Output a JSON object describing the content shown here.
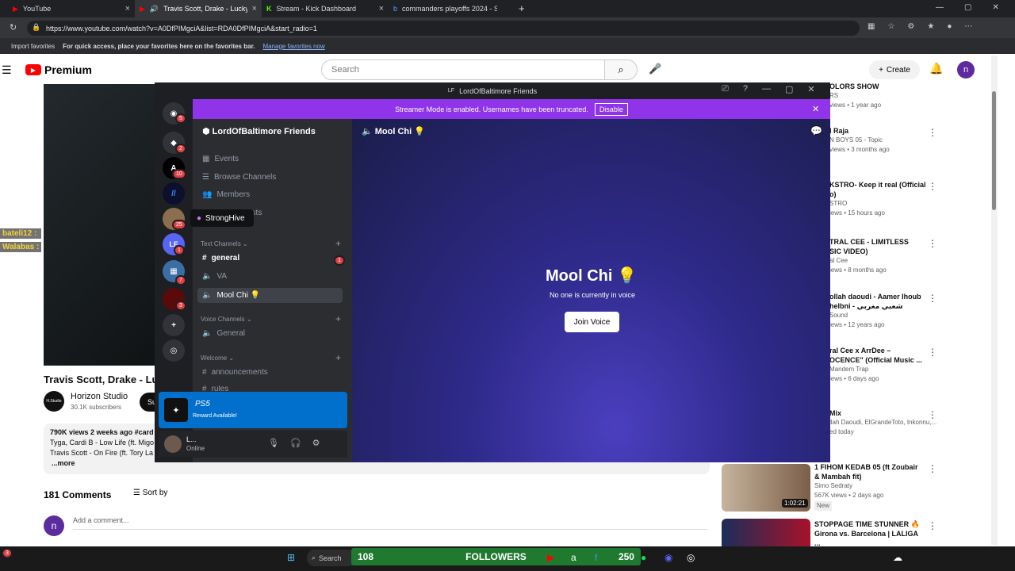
{
  "browser": {
    "tabs": [
      {
        "label": "YouTube"
      },
      {
        "label": "Travis Scott, Drake - Lucky Y"
      },
      {
        "label": "Stream - Kick Dashboard"
      },
      {
        "label": "commanders playoffs 2024 - Sea"
      }
    ],
    "url": "https://www.youtube.com/watch?v=A0DfPIMgciA&list=RDA0DfPIMgciA&start_radio=1",
    "favorites": {
      "import": "Import favorites",
      "hint": "For quick access, place your favorites here on the favorites bar.",
      "manage": "Manage favorites now"
    }
  },
  "youtube": {
    "logo": "Premium",
    "search_placeholder": "Search",
    "create": "Create",
    "avatar": "n",
    "video_title": "Travis Scott, Drake - Lu",
    "channel": {
      "name": "Horizon Studio",
      "subs": "30.1K subscribers",
      "logo_text": "H.Studio",
      "subscribe": "Su"
    },
    "desc": {
      "meta": "790K views  2 weeks ago  #card",
      "line1": "Tyga, Cardi B - Low Life (ft. Migo",
      "line2": "Travis Scott - On Fire (ft. Tory La",
      "more": "...more"
    },
    "comments": "181 Comments",
    "sort": "Sort by",
    "add_comment": "Add a comment...",
    "recs": [
      {
        "t": "OLORS SHOW",
        "m1": "RS",
        "m2": "views • 1 year ago"
      },
      {
        "t": "l Raja",
        "m1": "N BOYS 05 - Topic",
        "m2": "views • 3 months ago"
      },
      {
        "t": "KSTRO- Keep it real (Official",
        "t2": "o)",
        "m1": "STRO",
        "m2": "iews • 15 hours ago"
      },
      {
        "t": "TRAL CEE - LIMITLESS",
        "t2": "SIC VIDEO)",
        "m1": "al Cee",
        "m2": "iews • 8 months ago"
      },
      {
        "t": "ollah daoudi - Aamer lhoub",
        "t2": "helbni - شعبي مغربي",
        "m1": "Sound",
        "m2": "iews • 12 years ago"
      },
      {
        "t": "ral Cee x ArrDee –",
        "t2": "OCENCE\" (Official Music ...",
        "m1": "Mandem Trap",
        "m2": "iews • 6 days ago"
      },
      {
        "t": "Mix",
        "m1": "llah Daoudi, ElGrandeToto, Inkonnu,...",
        "m2": "ed today"
      },
      {
        "t": "1 FIHOM KEDAB 05 (ft Zoubair",
        "t2": "& Mambah fit)",
        "m1": "Simo Sedraty",
        "m2": "567K views • 2 days ago",
        "m3": "New",
        "dur": "1:02:21"
      },
      {
        "t": "STOPPAGE TIME STUNNER 🔥",
        "t2": "Girona vs. Barcelona | LALIGA ..."
      }
    ]
  },
  "overlay": {
    "chat1": "bateli12 :",
    "chat2": "Walabas :"
  },
  "discord": {
    "window_title": "LordOfBaltimore Friends",
    "window_badge": "LF",
    "banner": "Streamer Mode is enabled. Usernames have been truncated.",
    "banner_btn": "Disable",
    "server_name": "LordOfBaltimore Friends",
    "nav": [
      "Events",
      "Browse Channels",
      "Members",
      "osts"
    ],
    "tooltip": "StrongHive",
    "cat_text": "Text Channels",
    "text_channels": [
      "general",
      "VA",
      "Mool Chi 💡"
    ],
    "cat_voice": "Voice Channels",
    "voice_channels": [
      "General"
    ],
    "cat_welcome": "Welcome",
    "welcome_channels": [
      "announcements",
      "rules"
    ],
    "general_badge": "1",
    "server_badges": [
      "5",
      "2",
      "10",
      "25",
      "1",
      "7",
      "3"
    ],
    "server_lf": "LF",
    "ps5": {
      "title": "PS5",
      "sub": "Reward Available!"
    },
    "user": {
      "name": "L...",
      "status": "Online"
    },
    "header": "Mool Chi 💡",
    "vc_title": "Mool Chi 💡",
    "vc_sub": "No one is currently in voice",
    "join": "Join Voice"
  },
  "taskbar": {
    "search": "Search",
    "followers": "FOLLOWERS",
    "count_left": "108",
    "count_right": "250",
    "corner_badge": "3"
  }
}
